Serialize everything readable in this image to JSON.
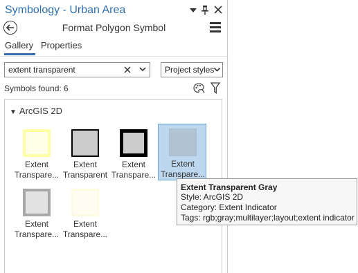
{
  "pane": {
    "title": "Symbology - Urban Area",
    "subtitle": "Format Polygon Symbol",
    "title_color": "#2f6fad"
  },
  "titlebar_icons": [
    "dropdown-icon",
    "pin-icon",
    "close-icon"
  ],
  "tabs": [
    {
      "label": "Gallery",
      "active": true
    },
    {
      "label": "Properties",
      "active": false
    }
  ],
  "search": {
    "value": "extent transparent",
    "placeholder": ""
  },
  "style_filter": {
    "selected": "Project styles"
  },
  "results": {
    "found_text": "Symbols found: 6"
  },
  "gallery": {
    "group": "ArcGIS 2D",
    "symbols": [
      {
        "line1": "Extent",
        "line2": "Transpare...",
        "selected": false
      },
      {
        "line1": "Extent",
        "line2": "Transparent",
        "selected": false
      },
      {
        "line1": "Extent",
        "line2": "Transpare...",
        "selected": false
      },
      {
        "line1": "Extent",
        "line2": "Transpare...",
        "selected": true
      },
      {
        "line1": "Extent",
        "line2": "Transpare...",
        "selected": false
      },
      {
        "line1": "Extent",
        "line2": "Transpare...",
        "selected": false
      }
    ]
  },
  "tooltip": {
    "title": "Extent Transparent Gray",
    "style": "Style: ArcGIS 2D",
    "category": "Category: Extent Indicator",
    "tags": "Tags: rgb;gray;multilayer;layout;extent indicator"
  },
  "colors": {
    "accent": "#2f6fad",
    "selection": "#bdd7ee"
  }
}
